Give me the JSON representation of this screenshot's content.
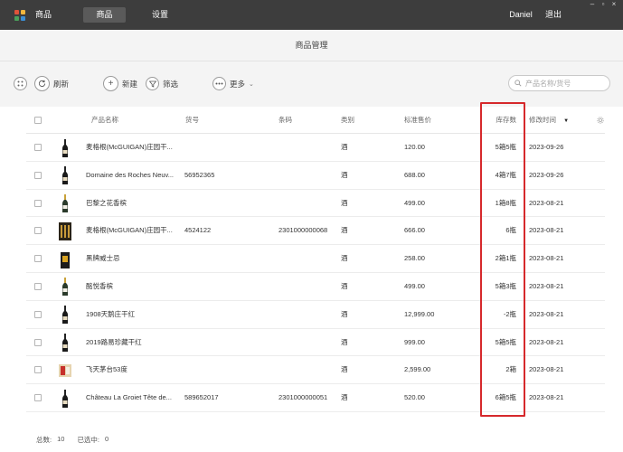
{
  "nav": {
    "items": [
      {
        "label": "商品",
        "active": false
      },
      {
        "label": "商品",
        "active": true
      },
      {
        "label": "设置",
        "active": false
      }
    ],
    "user": "Daniel",
    "logout": "退出"
  },
  "page_title": "商品管理",
  "toolbar": {
    "refresh": "刷新",
    "new": "新建",
    "filter": "筛选",
    "more": "更多",
    "search_placeholder": "产品名称/货号"
  },
  "table": {
    "headers": {
      "name": "产品名称",
      "sku": "货号",
      "barcode": "条码",
      "category": "类别",
      "price": "标准售价",
      "stock": "库存数",
      "modified": "修改时间"
    },
    "rows": [
      {
        "name": "麦格根(McGUIGAN)庄园干...",
        "sku": "",
        "barcode": "",
        "category": "酒",
        "price": "120.00",
        "stock": "5箱5瓶",
        "modified": "2023-09-26",
        "thumb": "dark-bottle"
      },
      {
        "name": "Domaine des Roches Neuv...",
        "sku": "56952365",
        "barcode": "",
        "category": "酒",
        "price": "688.00",
        "stock": "4箱7瓶",
        "modified": "2023-09-26",
        "thumb": "dark-bottle"
      },
      {
        "name": "巴黎之花香槟",
        "sku": "",
        "barcode": "",
        "category": "酒",
        "price": "499.00",
        "stock": "1箱8瓶",
        "modified": "2023-08-21",
        "thumb": "champagne-bottle"
      },
      {
        "name": "麦格根(McGUIGAN)庄园干...",
        "sku": "4524122",
        "barcode": "2301000000068",
        "category": "酒",
        "price": "666.00",
        "stock": "6瓶",
        "modified": "2023-08-21",
        "thumb": "wine-case"
      },
      {
        "name": "黑牌威士忌",
        "sku": "",
        "barcode": "",
        "category": "酒",
        "price": "258.00",
        "stock": "2箱1瓶",
        "modified": "2023-08-21",
        "thumb": "whisky-box"
      },
      {
        "name": "酩悦香槟",
        "sku": "",
        "barcode": "",
        "category": "酒",
        "price": "499.00",
        "stock": "5箱3瓶",
        "modified": "2023-08-21",
        "thumb": "champagne-bottle"
      },
      {
        "name": "1908天鹅庄干红",
        "sku": "",
        "barcode": "",
        "category": "酒",
        "price": "12,999.00",
        "stock": "-2瓶",
        "modified": "2023-08-21",
        "thumb": "dark-bottle"
      },
      {
        "name": "2019路易珍藏干红",
        "sku": "",
        "barcode": "",
        "category": "酒",
        "price": "999.00",
        "stock": "5箱5瓶",
        "modified": "2023-08-21",
        "thumb": "dark-bottle"
      },
      {
        "name": "飞天茅台53度",
        "sku": "",
        "barcode": "",
        "category": "酒",
        "price": "2,599.00",
        "stock": "2箱",
        "modified": "2023-08-21",
        "thumb": "moutai-box"
      },
      {
        "name": "Château La Groiet Tête de...",
        "sku": "589652017",
        "barcode": "2301000000051",
        "category": "酒",
        "price": "520.00",
        "stock": "6箱5瓶",
        "modified": "2023-08-21",
        "thumb": "dark-bottle"
      }
    ]
  },
  "footer": {
    "total_label": "总数:",
    "total": "10",
    "selected_label": "已选中:",
    "selected": "0"
  },
  "colors": {
    "topbar": "#3d3d3d",
    "highlight": "#d6292c"
  }
}
